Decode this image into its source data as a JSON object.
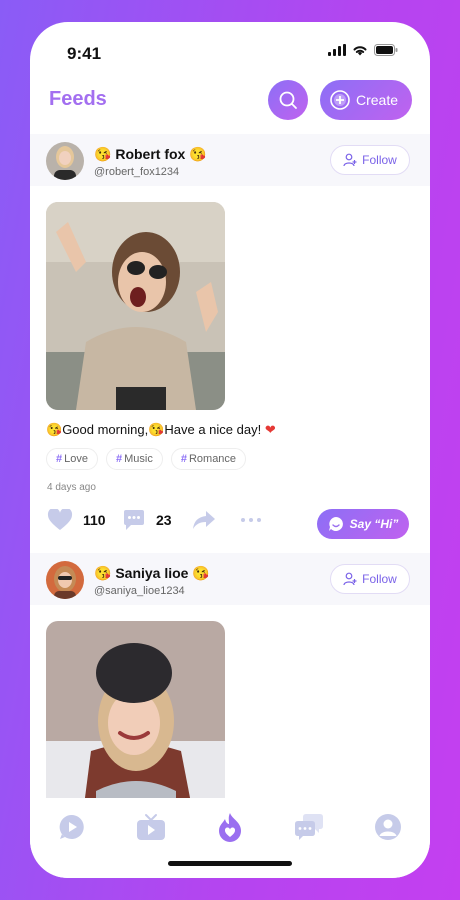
{
  "status": {
    "time": "9:41"
  },
  "header": {
    "title": "Feeds",
    "create_label": "Create"
  },
  "posts": [
    {
      "name": "Robert fox",
      "handle": "@robert_fox1234",
      "follow_label": "Follow",
      "caption": "Good morning,",
      "caption_tail": "Have a nice day!",
      "tags": [
        "Love",
        "Music",
        "Romance"
      ],
      "time_ago": "4 days ago",
      "likes": "110",
      "comments": "23",
      "say_hi_label": "Say “Hi”"
    },
    {
      "name": "Saniya lioe",
      "handle": "@saniya_lioe1234",
      "follow_label": "Follow"
    }
  ],
  "tabbar": {
    "items": [
      "play-icon",
      "tv-icon",
      "flame-heart-icon",
      "chat-icon",
      "profile-icon"
    ]
  },
  "colors": {
    "accent": "#8c6ff6",
    "accent2": "#c062ef",
    "title": "#a36ff0"
  }
}
